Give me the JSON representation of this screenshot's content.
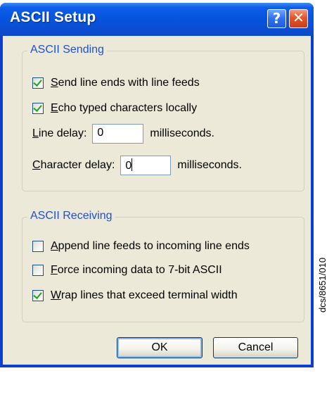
{
  "window": {
    "title": "ASCII Setup",
    "help_glyph": "?",
    "close_glyph": "✕"
  },
  "sending": {
    "legend": "ASCII Sending",
    "send_line_ends": {
      "accel": "S",
      "rest": "end line ends with line feeds",
      "checked": true
    },
    "echo_typed": {
      "accel": "E",
      "rest": "cho typed characters locally",
      "checked": true
    },
    "line_delay": {
      "label_accel": "L",
      "label_rest": "ine delay:",
      "value": "0",
      "unit": "milliseconds."
    },
    "char_delay": {
      "label_accel": "C",
      "label_rest": "haracter delay:",
      "value": "0",
      "unit": "milliseconds."
    }
  },
  "receiving": {
    "legend": "ASCII Receiving",
    "append_line_feeds": {
      "accel": "A",
      "rest": "ppend line feeds to incoming line ends",
      "checked": false
    },
    "force_7bit": {
      "accel": "F",
      "rest": "orce incoming data to 7-bit ASCII",
      "checked": false
    },
    "wrap_lines": {
      "accel": "W",
      "rest": "rap lines that exceed terminal width",
      "checked": true
    }
  },
  "buttons": {
    "ok": "OK",
    "cancel": "Cancel"
  },
  "side_caption": "dcs/8651/010",
  "colors": {
    "titlebar_blue": "#0654e0",
    "dialog_face": "#ece9d8",
    "group_label_blue": "#1f4fd3",
    "check_green": "#21a121",
    "close_red": "#e0572c"
  },
  "icons": {
    "help": "question-mark-icon",
    "close": "close-x-icon",
    "check": "checkmark-icon"
  }
}
